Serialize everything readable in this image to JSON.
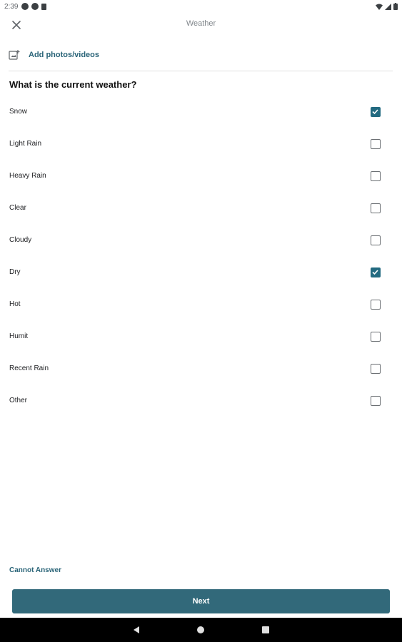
{
  "status_bar": {
    "time": "2:39"
  },
  "app_bar": {
    "title": "Weather"
  },
  "media": {
    "add_label": "Add photos/videos"
  },
  "question": {
    "text": "What is the current weather?"
  },
  "options": [
    {
      "label": "Snow",
      "checked": true
    },
    {
      "label": "Light Rain",
      "checked": false
    },
    {
      "label": "Heavy Rain",
      "checked": false
    },
    {
      "label": "Clear",
      "checked": false
    },
    {
      "label": "Cloudy",
      "checked": false
    },
    {
      "label": "Dry",
      "checked": true
    },
    {
      "label": "Hot",
      "checked": false
    },
    {
      "label": "Humit",
      "checked": false
    },
    {
      "label": "Recent Rain",
      "checked": false
    },
    {
      "label": "Other",
      "checked": false
    }
  ],
  "actions": {
    "cannot_answer": "Cannot Answer",
    "next": "Next"
  },
  "colors": {
    "accent": "#226a80",
    "button": "#32697a"
  }
}
